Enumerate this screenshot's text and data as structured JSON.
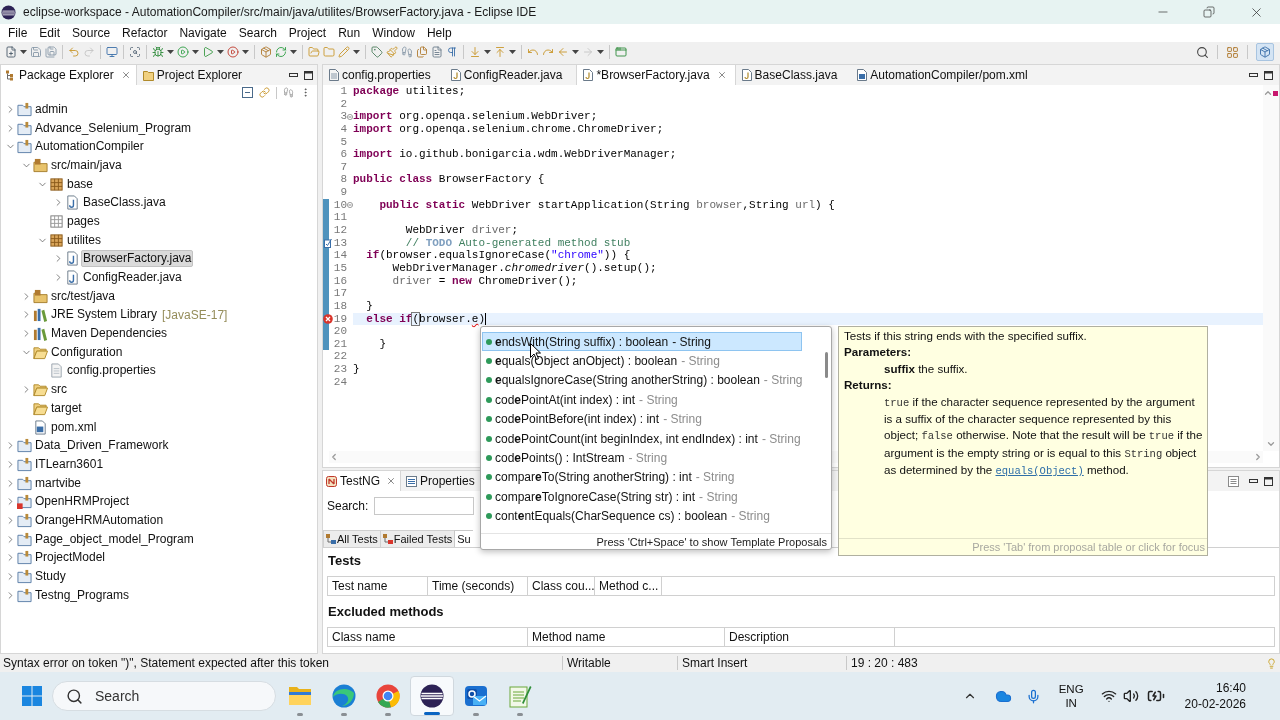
{
  "window": {
    "title": "eclipse-workspace - AutomationCompiler/src/main/java/utilites/BrowserFactory.java - Eclipse IDE"
  },
  "menu": [
    "File",
    "Edit",
    "Source",
    "Refactor",
    "Navigate",
    "Search",
    "Project",
    "Run",
    "Window",
    "Help"
  ],
  "explorer": {
    "tabs": [
      {
        "label": "Package Explorer",
        "kind": "packages",
        "selected": true
      },
      {
        "label": "Project Explorer",
        "kind": "projects",
        "selected": false
      }
    ],
    "tree": [
      {
        "label": "admin",
        "kind": "project",
        "error": false,
        "expanded": false,
        "selected": false
      },
      {
        "label": "Advance_Selenium_Program",
        "kind": "project",
        "error": false,
        "expanded": false,
        "selected": false
      },
      {
        "label": "AutomationCompiler",
        "kind": "project",
        "error": false,
        "expanded": true,
        "selected": false,
        "children": [
          {
            "label": "src/main/java",
            "kind": "source-folder",
            "expanded": true,
            "selected": false,
            "children": [
              {
                "label": "base",
                "kind": "package",
                "expanded": true,
                "selected": false,
                "children": [
                  {
                    "label": "BaseClass.java",
                    "kind": "java-file",
                    "expanded": false,
                    "selected": false
                  }
                ]
              },
              {
                "label": "pages",
                "kind": "empty-package",
                "selected": false
              },
              {
                "label": "utilites",
                "kind": "package",
                "expanded": true,
                "selected": false,
                "children": [
                  {
                    "label": "BrowserFactory.java",
                    "kind": "java-file",
                    "expanded": false,
                    "selected": true
                  },
                  {
                    "label": "ConfigReader.java",
                    "kind": "java-file",
                    "expanded": false,
                    "selected": false
                  }
                ]
              }
            ]
          },
          {
            "label": "src/test/java",
            "kind": "source-folder",
            "expanded": false,
            "selected": false
          },
          {
            "label": "JRE System Library",
            "decoration": "[JavaSE-17]",
            "kind": "library",
            "expanded": false,
            "selected": false
          },
          {
            "label": "Maven Dependencies",
            "kind": "library",
            "expanded": false,
            "selected": false
          },
          {
            "label": "Configuration",
            "kind": "folder",
            "expanded": true,
            "selected": false,
            "children": [
              {
                "label": "config.properties",
                "kind": "file",
                "selected": false
              }
            ]
          },
          {
            "label": "src",
            "kind": "folder",
            "expanded": false,
            "selected": false
          },
          {
            "label": "target",
            "kind": "folder",
            "selected": false
          },
          {
            "label": "pom.xml",
            "kind": "xml-file",
            "selected": false
          }
        ]
      },
      {
        "label": "Data_Driven_Framework",
        "kind": "project",
        "error": false,
        "expanded": false,
        "selected": false
      },
      {
        "label": "ITLearn3601",
        "kind": "project",
        "error": false,
        "expanded": false,
        "selected": false
      },
      {
        "label": "martvibe",
        "kind": "project",
        "error": false,
        "expanded": false,
        "selected": false
      },
      {
        "label": "OpenHRMProject",
        "kind": "project",
        "error": true,
        "expanded": false,
        "selected": false
      },
      {
        "label": "OrangeHRMAutomation",
        "kind": "project",
        "error": false,
        "expanded": false,
        "selected": false
      },
      {
        "label": "Page_object_model_Program",
        "kind": "project",
        "error": false,
        "expanded": false,
        "selected": false
      },
      {
        "label": "ProjectModel",
        "kind": "project",
        "error": false,
        "expanded": false,
        "selected": false
      },
      {
        "label": "Study",
        "kind": "project",
        "error": false,
        "expanded": false,
        "selected": false
      },
      {
        "label": "Testng_Programs",
        "kind": "project",
        "error": false,
        "expanded": false,
        "selected": false
      }
    ]
  },
  "editor": {
    "tabs": [
      {
        "label": "config.properties",
        "kind": "properties",
        "selected": false
      },
      {
        "label": "ConfigReader.java",
        "kind": "java",
        "selected": false
      },
      {
        "label": "*BrowserFactory.java",
        "kind": "java",
        "selected": true
      },
      {
        "label": "BaseClass.java",
        "kind": "java",
        "selected": false
      },
      {
        "label": "AutomationCompiler/pom.xml",
        "kind": "xml",
        "selected": false
      }
    ],
    "lines": [
      {
        "number": "1",
        "kind": "plain",
        "current": false,
        "range": false,
        "tokens": [
          {
            "kind": "keyword",
            "text": "package"
          },
          {
            "kind": "plain",
            "text": " utilites;"
          }
        ]
      },
      {
        "number": "2",
        "kind": "plain",
        "current": false,
        "range": false
      },
      {
        "number": "3",
        "kind": "fold",
        "current": false,
        "range": false,
        "tokens": [
          {
            "kind": "keyword",
            "text": "import"
          },
          {
            "kind": "plain",
            "text": " org.openqa.selenium.WebDriver;"
          }
        ]
      },
      {
        "number": "4",
        "kind": "plain",
        "current": false,
        "range": false,
        "tokens": [
          {
            "kind": "keyword",
            "text": "import"
          },
          {
            "kind": "plain",
            "text": " org.openqa.selenium.chrome.ChromeDriver;"
          }
        ]
      },
      {
        "number": "5",
        "kind": "plain",
        "current": false,
        "range": false
      },
      {
        "number": "6",
        "kind": "plain",
        "current": false,
        "range": false,
        "tokens": [
          {
            "kind": "keyword",
            "text": "import"
          },
          {
            "kind": "plain",
            "text": " io.github.bonigarcia.wdm.WebDriverManager;"
          }
        ]
      },
      {
        "number": "7",
        "kind": "plain",
        "current": false,
        "range": false
      },
      {
        "number": "8",
        "kind": "plain",
        "current": false,
        "range": false,
        "tokens": [
          {
            "kind": "keyword",
            "text": "public class"
          },
          {
            "kind": "plain",
            "text": " BrowserFactory {"
          }
        ]
      },
      {
        "number": "9",
        "kind": "plain",
        "current": false,
        "range": false
      },
      {
        "number": "10",
        "kind": "fold",
        "current": false,
        "range": true,
        "tokens": [
          {
            "kind": "keyword",
            "text": "    public static"
          },
          {
            "kind": "plain",
            "text": " WebDriver startApplication(String "
          },
          {
            "kind": "variable",
            "text": "browser"
          },
          {
            "kind": "plain",
            "text": ",String "
          },
          {
            "kind": "variable",
            "text": "url"
          },
          {
            "kind": "plain",
            "text": ") {"
          }
        ]
      },
      {
        "number": "11",
        "kind": "plain",
        "current": false,
        "range": true
      },
      {
        "number": "12",
        "kind": "plain",
        "current": false,
        "range": true,
        "tokens": [
          {
            "kind": "plain",
            "text": "        WebDriver "
          },
          {
            "kind": "variable",
            "text": "driver"
          },
          {
            "kind": "plain",
            "text": ";"
          }
        ]
      },
      {
        "number": "13",
        "kind": "task",
        "current": false,
        "range": true,
        "tokens": [
          {
            "kind": "comment",
            "text": "        // "
          },
          {
            "kind": "todo",
            "text": "TODO"
          },
          {
            "kind": "comment",
            "text": " Auto-generated method stub"
          }
        ]
      },
      {
        "number": "14",
        "kind": "plain",
        "current": false,
        "range": true,
        "tokens": [
          {
            "kind": "keyword",
            "text": "  if"
          },
          {
            "kind": "plain",
            "text": "(browser.equalsIgnoreCase("
          },
          {
            "kind": "string",
            "text": "\"chrome\""
          },
          {
            "kind": "plain",
            "text": ")) {"
          }
        ]
      },
      {
        "number": "15",
        "kind": "plain",
        "current": false,
        "range": true,
        "tokens": [
          {
            "kind": "plain",
            "text": "      WebDriverManager."
          },
          {
            "kind": "static",
            "text": "chromedriver"
          },
          {
            "kind": "plain",
            "text": "().setup();"
          }
        ]
      },
      {
        "number": "16",
        "kind": "plain",
        "current": false,
        "range": true,
        "tokens": [
          {
            "kind": "variable",
            "text": "      driver"
          },
          {
            "kind": "plain",
            "text": " = "
          },
          {
            "kind": "keyword",
            "text": "new"
          },
          {
            "kind": "plain",
            "text": " ChromeDriver();"
          }
        ]
      },
      {
        "number": "17",
        "kind": "plain",
        "current": false,
        "range": true
      },
      {
        "number": "18",
        "kind": "plain",
        "current": false,
        "range": true,
        "tokens": [
          {
            "kind": "plain",
            "text": "  }"
          }
        ]
      },
      {
        "number": "19",
        "kind": "error",
        "current": true,
        "range": true,
        "tokens": [
          {
            "kind": "keyword",
            "text": "  else if"
          },
          {
            "kind": "bracket",
            "text": "("
          },
          {
            "kind": "plain",
            "text": "browser."
          },
          {
            "kind": "error",
            "text": "e"
          },
          {
            "kind": "plain",
            "text": ")"
          }
        ]
      },
      {
        "number": "20",
        "kind": "plain",
        "current": false,
        "range": true
      },
      {
        "number": "21",
        "kind": "plain",
        "current": false,
        "range": true,
        "tokens": [
          {
            "kind": "plain",
            "text": "    }"
          }
        ]
      },
      {
        "number": "22",
        "kind": "plain",
        "current": false,
        "range": false
      },
      {
        "number": "23",
        "kind": "plain",
        "current": false,
        "range": false,
        "tokens": [
          {
            "kind": "plain",
            "text": "}"
          }
        ]
      },
      {
        "number": "24",
        "kind": "plain",
        "current": false,
        "range": false
      }
    ]
  },
  "content_assist": {
    "proposals": [
      {
        "signature": "**e**ndsWith(String suffix) : boolean",
        "declaring_type": "- String",
        "selected": true
      },
      {
        "signature": "**e**quals(Object anObject) : boolean",
        "declaring_type": "- String",
        "selected": false
      },
      {
        "signature": "**e**qualsIgnoreCase(String anotherString) : boolean",
        "declaring_type": "- String",
        "selected": false
      },
      {
        "signature": "cod**e**PointAt(int index) : int",
        "declaring_type": "- String",
        "selected": false
      },
      {
        "signature": "cod**e**PointBefore(int index) : int",
        "declaring_type": "- String",
        "selected": false
      },
      {
        "signature": "cod**e**PointCount(int beginIndex, int endIndex) : int",
        "declaring_type": "- String",
        "selected": false
      },
      {
        "signature": "cod**e**Points() : IntStream",
        "declaring_type": "- String",
        "selected": false
      },
      {
        "signature": "compar**e**To(String anotherString) : int",
        "declaring_type": "- String",
        "selected": false
      },
      {
        "signature": "compar**e**ToIgnoreCase(String str) : int",
        "declaring_type": "- String",
        "selected": false
      },
      {
        "signature": "cont**e**ntEquals(CharSequence cs) : boolean",
        "declaring_type": "- String",
        "selected": false
      }
    ],
    "footer": "Press 'Ctrl+Space' to show Template Proposals"
  },
  "javadoc": {
    "summary": "Tests if this string ends with the specified suffix.",
    "parameters_heading": "Parameters:",
    "parameter": "**suffix** the suffix.",
    "returns_heading": "Returns:",
    "returns": [
      {
        "kind": "code",
        "text": "true"
      },
      {
        "kind": "text",
        "text": " if the character sequence represented by the argument is a suffix of the character sequence represented by this object; "
      },
      {
        "kind": "code",
        "text": "false"
      },
      {
        "kind": "text",
        "text": " otherwise. Note that the result will be "
      },
      {
        "kind": "code",
        "text": "true"
      },
      {
        "kind": "text",
        "text": " if the argument is the empty string or is equal to this "
      },
      {
        "kind": "code",
        "text": "String"
      },
      {
        "kind": "text",
        "text": " object as determined by the "
      },
      {
        "kind": "link",
        "text": "equals(Object)"
      },
      {
        "kind": "text",
        "text": " method."
      }
    ],
    "footer": "Press 'Tab' from proposal table or click for focus"
  },
  "bottom_panel": {
    "tabs": [
      {
        "label": "TestNG",
        "kind": "testng",
        "selected": true
      },
      {
        "label": "Properties",
        "kind": "properties",
        "selected": false
      }
    ],
    "search_label": "Search:",
    "result_tabs": [
      {
        "label": "All Tests",
        "kind": "all",
        "selected": false
      },
      {
        "label": "Failed Tests",
        "kind": "failed",
        "selected": false
      },
      {
        "label": "Su",
        "selected": true
      }
    ],
    "tests_heading": "Tests",
    "tests_columns": [
      "Test name",
      "Time (seconds)",
      "Class cou...",
      "Method c..."
    ],
    "excluded_heading": "Excluded methods",
    "excluded_columns": [
      "Class name",
      "Method name",
      "Description"
    ]
  },
  "status_bar": {
    "message": "Syntax error on token \")\", Statement expected after this token",
    "mode": "Writable",
    "insert_mode": "Smart Insert",
    "position": "19 : 20 : 483"
  },
  "taskbar": {
    "search_label": "Search",
    "apps": [
      {
        "kind": "files",
        "selected": false
      },
      {
        "kind": "browser-wave",
        "selected": false
      },
      {
        "kind": "browser-ring",
        "selected": false
      },
      {
        "kind": "ide",
        "selected": true
      },
      {
        "kind": "mail",
        "selected": false
      },
      {
        "kind": "notepad",
        "selected": false
      }
    ],
    "language": "ENG",
    "region": "IN",
    "time": "16:40",
    "date": "20-02-2026"
  }
}
